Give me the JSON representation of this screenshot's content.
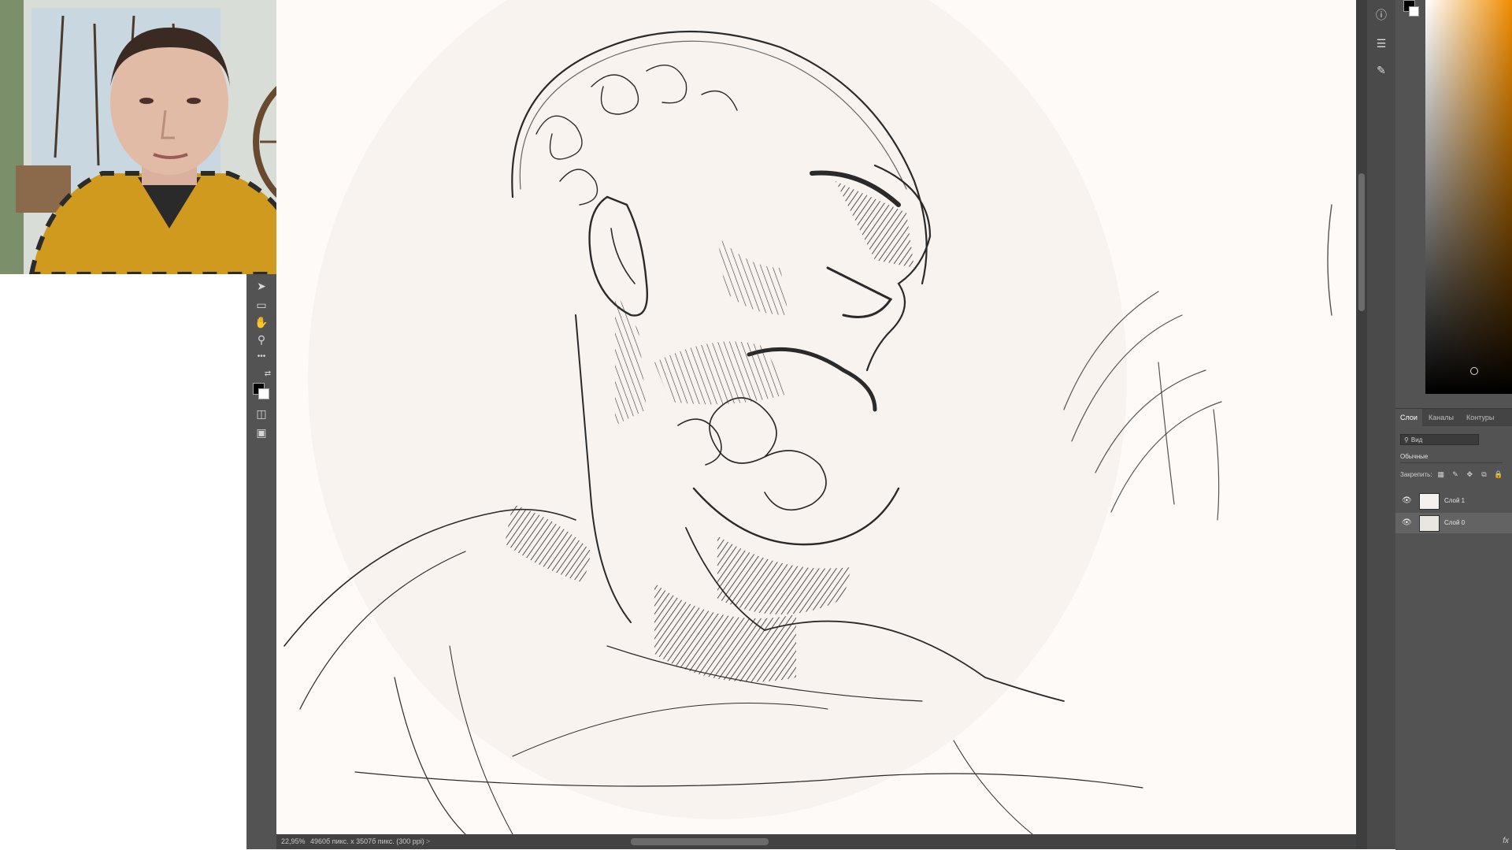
{
  "status_bar": {
    "zoom": "22,95%",
    "doc_info": "4960б пикс. x 3507б пикс. (300 ppi)",
    "arrow": ">"
  },
  "toolbar": {
    "tools": [
      {
        "name": "move-tool-icon",
        "glyph": "➤"
      },
      {
        "name": "marquee-tool-icon",
        "glyph": "▭"
      },
      {
        "name": "hand-tool-icon",
        "glyph": "✋"
      },
      {
        "name": "zoom-tool-icon",
        "glyph": "⚲"
      },
      {
        "name": "more-tools-icon",
        "glyph": "•••"
      },
      {
        "name": "swap-colors-icon",
        "glyph": "⇄"
      },
      {
        "name": "quick-mask-icon",
        "glyph": "◫"
      },
      {
        "name": "screen-mode-icon",
        "glyph": "▣"
      }
    ]
  },
  "dock": {
    "icons": [
      {
        "name": "info-icon",
        "glyph": "ⓘ"
      },
      {
        "name": "adjustments-icon",
        "glyph": "☰"
      },
      {
        "name": "brush-settings-icon",
        "glyph": "✎"
      }
    ]
  },
  "layers_panel": {
    "tabs": [
      "Слои",
      "Каналы",
      "Контуры"
    ],
    "search_placeholder": "Вид",
    "blend_mode": "Обычные",
    "lock_label": "Закрепить:",
    "layers": [
      {
        "name": "Слой 1",
        "visible": true,
        "selected": false
      },
      {
        "name": "Слой 0",
        "visible": true,
        "selected": true
      }
    ],
    "fx_label": "fx"
  },
  "colors": {
    "ui_dark": "#535353",
    "ui_darker": "#424242",
    "canvas": "#fdfaf8",
    "accent_orange": "#f08c00",
    "sketch_ink": "#2a2a2a"
  }
}
